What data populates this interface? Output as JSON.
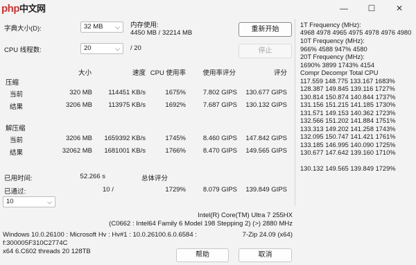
{
  "watermark": {
    "a": "php",
    "b": "中文网"
  },
  "window_controls": {
    "minimize": "—",
    "maximize": "☐",
    "close": "✕"
  },
  "dictionary": {
    "label": "字典大小(D):",
    "value": "32 MB"
  },
  "threads": {
    "label": "CPU 线程数:",
    "value": "20",
    "total": "/ 20"
  },
  "memory": {
    "label": "内存使用:",
    "value": "4450 MB / 32214 MB"
  },
  "buttons": {
    "restart": "重新开始",
    "stop": "停止",
    "help": "帮助",
    "cancel": "取消"
  },
  "table_headers": {
    "size": "大小",
    "speed": "速度",
    "cpu": "CPU 使用率",
    "rating_per_usage": "使用率评分",
    "rating": "评分"
  },
  "compress": {
    "title": "压缩",
    "rows": [
      {
        "label": "当前",
        "size": "320 MB",
        "speed": "114451 KB/s",
        "cpu": "1675%",
        "rpu": "7.802 GIPS",
        "rating": "130.677 GIPS"
      },
      {
        "label": "结果",
        "size": "3206 MB",
        "speed": "113975 KB/s",
        "cpu": "1692%",
        "rpu": "7.687 GIPS",
        "rating": "130.132 GIPS"
      }
    ]
  },
  "decompress": {
    "title": "解压缩",
    "rows": [
      {
        "label": "当前",
        "size": "3206 MB",
        "speed": "1659392 KB/s",
        "cpu": "1745%",
        "rpu": "8.460 GIPS",
        "rating": "147.842 GIPS"
      },
      {
        "label": "结果",
        "size": "32062 MB",
        "speed": "1681001 KB/s",
        "cpu": "1766%",
        "rpu": "8.470 GIPS",
        "rating": "149.565 GIPS"
      }
    ]
  },
  "elapsed": {
    "label": "已用时间:",
    "value": "52.266 s"
  },
  "passes": {
    "label": "已通过:",
    "value": "10 /",
    "select_value": "10"
  },
  "total": {
    "label": "总体评分",
    "cpu": "1729%",
    "rpu": "8.079 GIPS",
    "rating": "139.849 GIPS"
  },
  "cpu_info": {
    "line1": "Intel(R) Core(TM) Ultra 7 255HX",
    "line2": "(C0662 : Intel64 Family 6 Model 198 Stepping 2) (>) 2880 MHz"
  },
  "sys_info": {
    "line1": "Windows 10.0.26100 : Microsoft Hv : Hv#1 : 10.0.26100.6.0.6584 :",
    "line2": "f:300005F310C2774C",
    "line3": "x64 6.C602 threads 20 128TB",
    "version": "7-Zip 24.09 (x64)"
  },
  "frequency": [
    "1T Frequency (MHz):",
    " 4968 4978 4965 4975 4978 4976 4980",
    "10T Frequency (MHz):",
    " 966% 4588 947% 4580",
    "20T Frequency (MHz):",
    " 1690% 3899 1743% 4154",
    "Compr Decompr Total  CPU",
    "117.559  148.775  133.167  1683%",
    "128.387  149.845  139.116  1727%",
    "130.814  150.874  140.844  1737%",
    "131.156  151.215  141.185  1730%",
    "131.571  149.153  140.362  1723%",
    "132.566  151.202  141.884  1751%",
    "133.313  149.202  141.258  1743%",
    "132.095  150.747  141.421  1761%",
    "133.185  146.995  140.090  1725%",
    "130.677  147.642  139.160  1710%",
    "",
    "130.132  149.565  139.849  1729%"
  ]
}
